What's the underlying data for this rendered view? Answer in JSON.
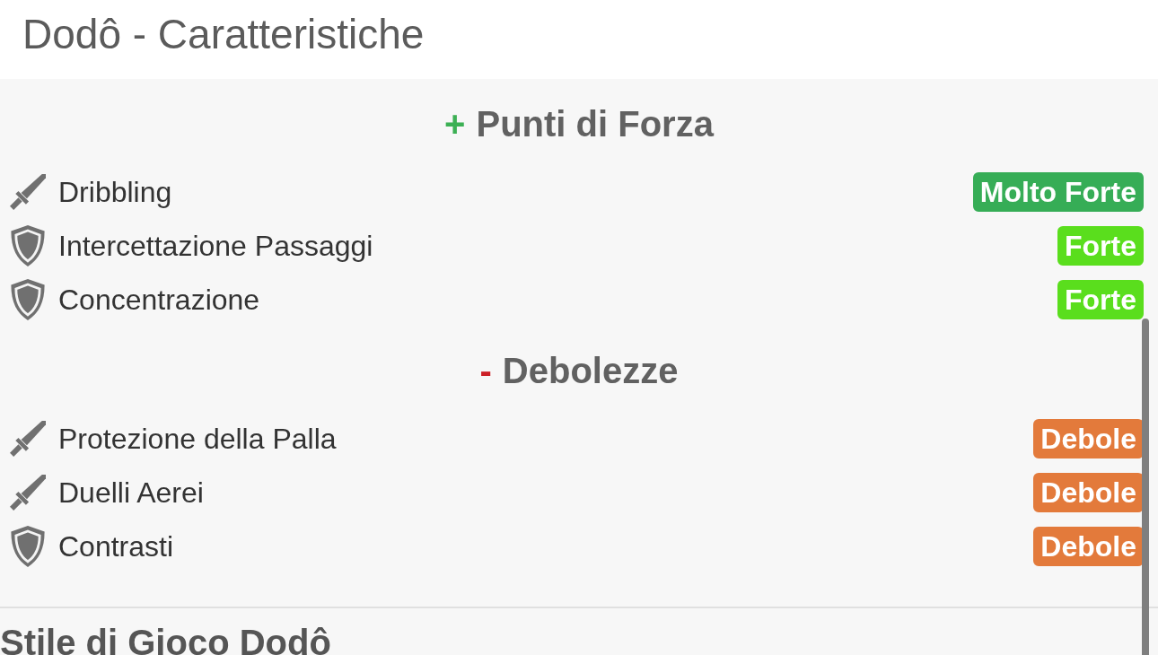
{
  "header": {
    "title": "Dodô - Caratteristiche"
  },
  "sections": [
    {
      "sign": "+",
      "color": "#3cb054",
      "title": "Punti di Forza",
      "items": [
        {
          "kind": "attack",
          "name": "Dribbling",
          "rating": "Molto Forte",
          "color": "#36ad56"
        },
        {
          "kind": "defense",
          "name": "Intercettazione Passaggi",
          "rating": "Forte",
          "color": "#5ade1d"
        },
        {
          "kind": "defense",
          "name": "Concentrazione",
          "rating": "Forte",
          "color": "#5ade1d"
        }
      ]
    },
    {
      "sign": "-",
      "color": "#cc2027",
      "title": "Debolezze",
      "items": [
        {
          "kind": "attack",
          "name": "Protezione della Palla",
          "rating": "Debole",
          "color": "#e37a3b"
        },
        {
          "kind": "attack",
          "name": "Duelli Aerei",
          "rating": "Debole",
          "color": "#e37a3b"
        },
        {
          "kind": "defense",
          "name": "Contrasti",
          "rating": "Debole",
          "color": "#e37a3b"
        }
      ]
    }
  ],
  "next_section": {
    "title": "Stile di Gioco Dodô"
  }
}
